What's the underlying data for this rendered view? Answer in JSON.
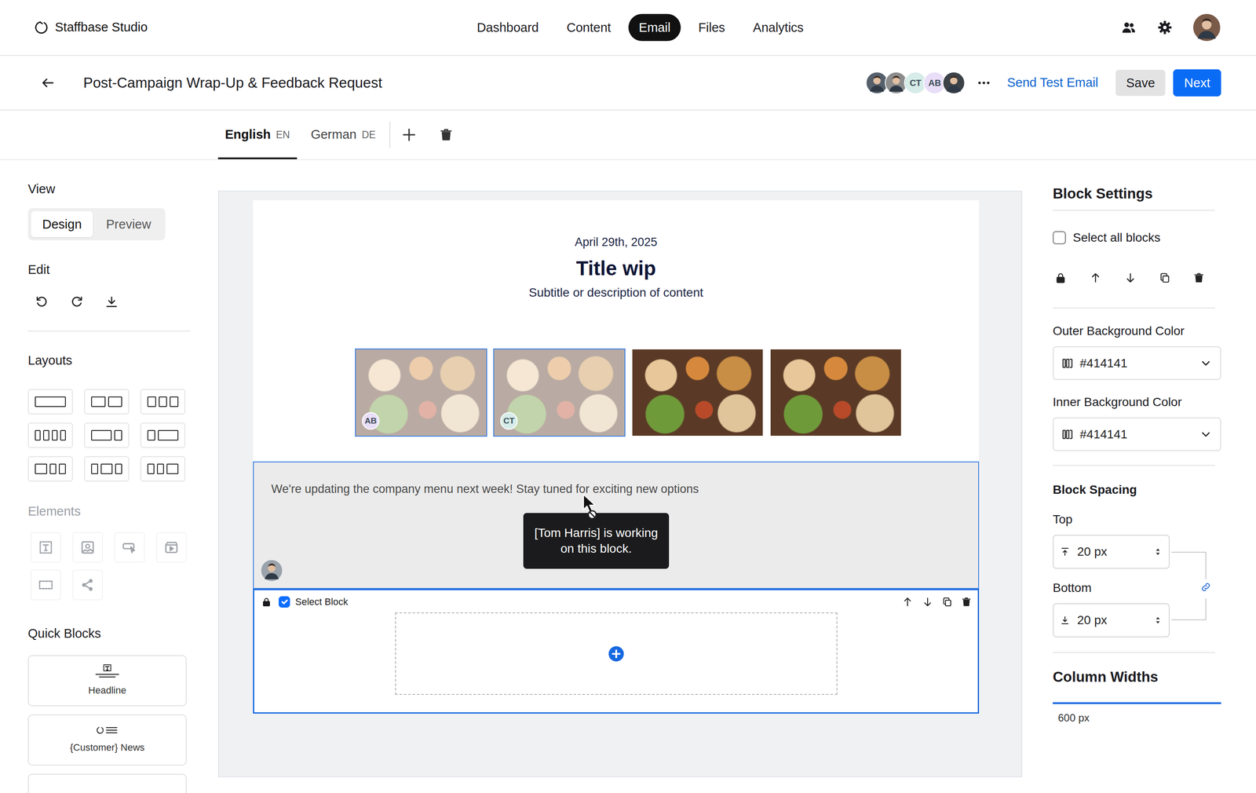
{
  "app": {
    "name": "Staffbase Studio"
  },
  "nav": [
    {
      "label": "Dashboard",
      "selected": false
    },
    {
      "label": "Content",
      "selected": false
    },
    {
      "label": "Email",
      "selected": true
    },
    {
      "label": "Files",
      "selected": false
    },
    {
      "label": "Analytics",
      "selected": false
    }
  ],
  "header": {
    "title": "Post-Campaign Wrap-Up & Feedback Request",
    "collaborators": [
      {
        "kind": "photo",
        "color": "#55606c"
      },
      {
        "kind": "photo",
        "color": "#8c8c8c"
      },
      {
        "kind": "initials",
        "initials": "CT",
        "color": "#d6ece8"
      },
      {
        "kind": "initials",
        "initials": "AB",
        "color": "#e9def7"
      },
      {
        "kind": "photo",
        "color": "#3d4248"
      }
    ],
    "send_test": "Send Test Email",
    "save": "Save",
    "next": "Next"
  },
  "languages": [
    {
      "label": "English",
      "code": "EN",
      "selected": true
    },
    {
      "label": "German",
      "code": "DE",
      "selected": false
    }
  ],
  "sidebar": {
    "view": {
      "label": "View",
      "options": [
        {
          "label": "Design",
          "selected": true
        },
        {
          "label": "Preview",
          "selected": false
        }
      ]
    },
    "edit": {
      "label": "Edit"
    },
    "layouts": {
      "label": "Layouts"
    },
    "elements": {
      "label": "Elements",
      "disabled": true
    },
    "quick_blocks": {
      "label": "Quick Blocks",
      "items": [
        {
          "label": "Headline",
          "kind": "headline"
        },
        {
          "label": "{Customer} News",
          "kind": "news"
        },
        {
          "kind": "imagetext"
        }
      ]
    }
  },
  "email": {
    "date": "April 29th, 2025",
    "title": "Title wip",
    "subtitle": "Subtitle or description of content",
    "images": [
      {
        "locked": true,
        "editor": "AB",
        "color": "#e9def7"
      },
      {
        "locked": true,
        "editor": "CT",
        "color": "#d6ece8"
      },
      {
        "locked": false
      },
      {
        "locked": false
      }
    ],
    "text_block": {
      "text": "We're updating the company menu next week! Stay tuned for exciting new options",
      "locked": true,
      "tooltip": "[Tom Harris] is working on this block."
    },
    "selected_block": {
      "select_label": "Select Block",
      "checked": true
    }
  },
  "settings": {
    "title": "Block Settings",
    "select_all": {
      "label": "Select all blocks",
      "checked": false
    },
    "outer_background": {
      "label": "Outer Background Color",
      "value": "#414141"
    },
    "inner_background": {
      "label": "Inner Background Color",
      "value": "#414141"
    },
    "spacing": {
      "label": "Block Spacing",
      "top": {
        "label": "Top",
        "value": "20 px"
      },
      "bottom": {
        "label": "Bottom",
        "value": "20 px"
      },
      "linked": true
    },
    "column_widths": {
      "label": "Column Widths",
      "value": "600 px",
      "level": 1
    }
  }
}
